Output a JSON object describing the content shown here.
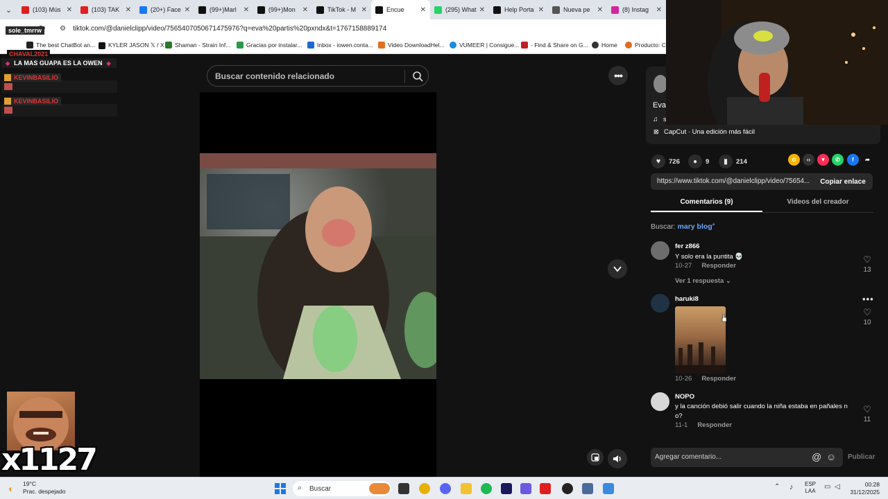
{
  "browser": {
    "tabs": [
      {
        "label": "(103) Mús",
        "color": "#e02020",
        "active": false
      },
      {
        "label": "(103) TAK",
        "color": "#e02020",
        "active": false
      },
      {
        "label": "(20+) Face",
        "color": "#1877f2",
        "active": false
      },
      {
        "label": "(99+)Marl",
        "color": "#111111",
        "active": false
      },
      {
        "label": "(99+)Mon",
        "color": "#111111",
        "active": false
      },
      {
        "label": "TikTok - M",
        "color": "#111111",
        "active": false
      },
      {
        "label": "Encue",
        "color": "#111111",
        "active": true
      },
      {
        "label": "(295) What",
        "color": "#25d366",
        "active": false
      },
      {
        "label": "Help Porta",
        "color": "#111111",
        "active": false
      },
      {
        "label": "Nueva pe",
        "color": "#555555",
        "active": false
      },
      {
        "label": "(8) Instag",
        "color": "#d6249f",
        "active": false
      }
    ],
    "url": "tiktok.com/@danielclipp/video/7565407050671475976?q=eva%20partis%20pxndx&t=1767158889174",
    "bookmarks": [
      "The best ChatBot an...",
      "KYLER JASON 𝕏 / X",
      "Shaman - Strain Inf...",
      "Gracias por instalar...",
      "Inbox - iowen.conta...",
      "Video DownloadHel...",
      "VUMEER | Consigue...",
      "- Find & Share on G...",
      "Home",
      "Producto: Co"
    ]
  },
  "overlay": {
    "streamer_name": "sole_tmrrw",
    "chaval": "CHAVAL2021",
    "banner": "LA MAS GUAPA ES LA OWEN",
    "users": [
      "KEVINBASILIO",
      "KEVINBASILIO"
    ],
    "combo": "x1127"
  },
  "search": {
    "placeholder": "Buscar contenido relacionado"
  },
  "video": {
    "creator": "Eva",
    "music": "s",
    "capcut": "CapCut · Una edición más fácil",
    "likes": "726",
    "comments": "9",
    "saves": "214",
    "link": "https://www.tiktok.com/@danielclipp/video/75654...",
    "copy_label": "Copiar enlace"
  },
  "share_icons": [
    {
      "name": "embed-icon",
      "color": "#f5b400",
      "glyph": "⊙"
    },
    {
      "name": "code-icon",
      "color": "#333333",
      "glyph": "‹›"
    },
    {
      "name": "send-icon",
      "color": "#fe2c55",
      "glyph": "▼"
    },
    {
      "name": "whatsapp-icon",
      "color": "#25d366",
      "glyph": "✆"
    },
    {
      "name": "facebook-icon",
      "color": "#1877f2",
      "glyph": "f"
    },
    {
      "name": "share-arrow-icon",
      "color": "#121212",
      "glyph": "➦"
    }
  ],
  "tabs": {
    "comments": "Comentarios (9)",
    "creator_videos": "Videos del creador"
  },
  "search_suggest": {
    "prefix": "Buscar:",
    "query": "mary blog"
  },
  "comments": [
    {
      "user": "fer z866",
      "text": "Y solo era la puntita 💀",
      "date": "10-27",
      "reply": "Responder",
      "likes": "13"
    },
    {
      "user": "haruki8",
      "text": "",
      "date": "10-26",
      "reply": "Responder",
      "likes": "10"
    },
    {
      "user": "NOPO",
      "text": "y la canción debió salir cuando la niña estaba en pañales n o?",
      "date": "11-1",
      "reply": "Responder",
      "likes": "11"
    }
  ],
  "view_replies": "Ver 1 respuesta",
  "add_comment": {
    "placeholder": "Agregar comentario...",
    "publish": "Publicar"
  },
  "taskbar": {
    "temp": "19°C",
    "weather": "Prac. despejado",
    "search": "Buscar",
    "lang1": "ESP",
    "lang2": "LAA",
    "time": "00:28",
    "date": "31/12/2025"
  }
}
